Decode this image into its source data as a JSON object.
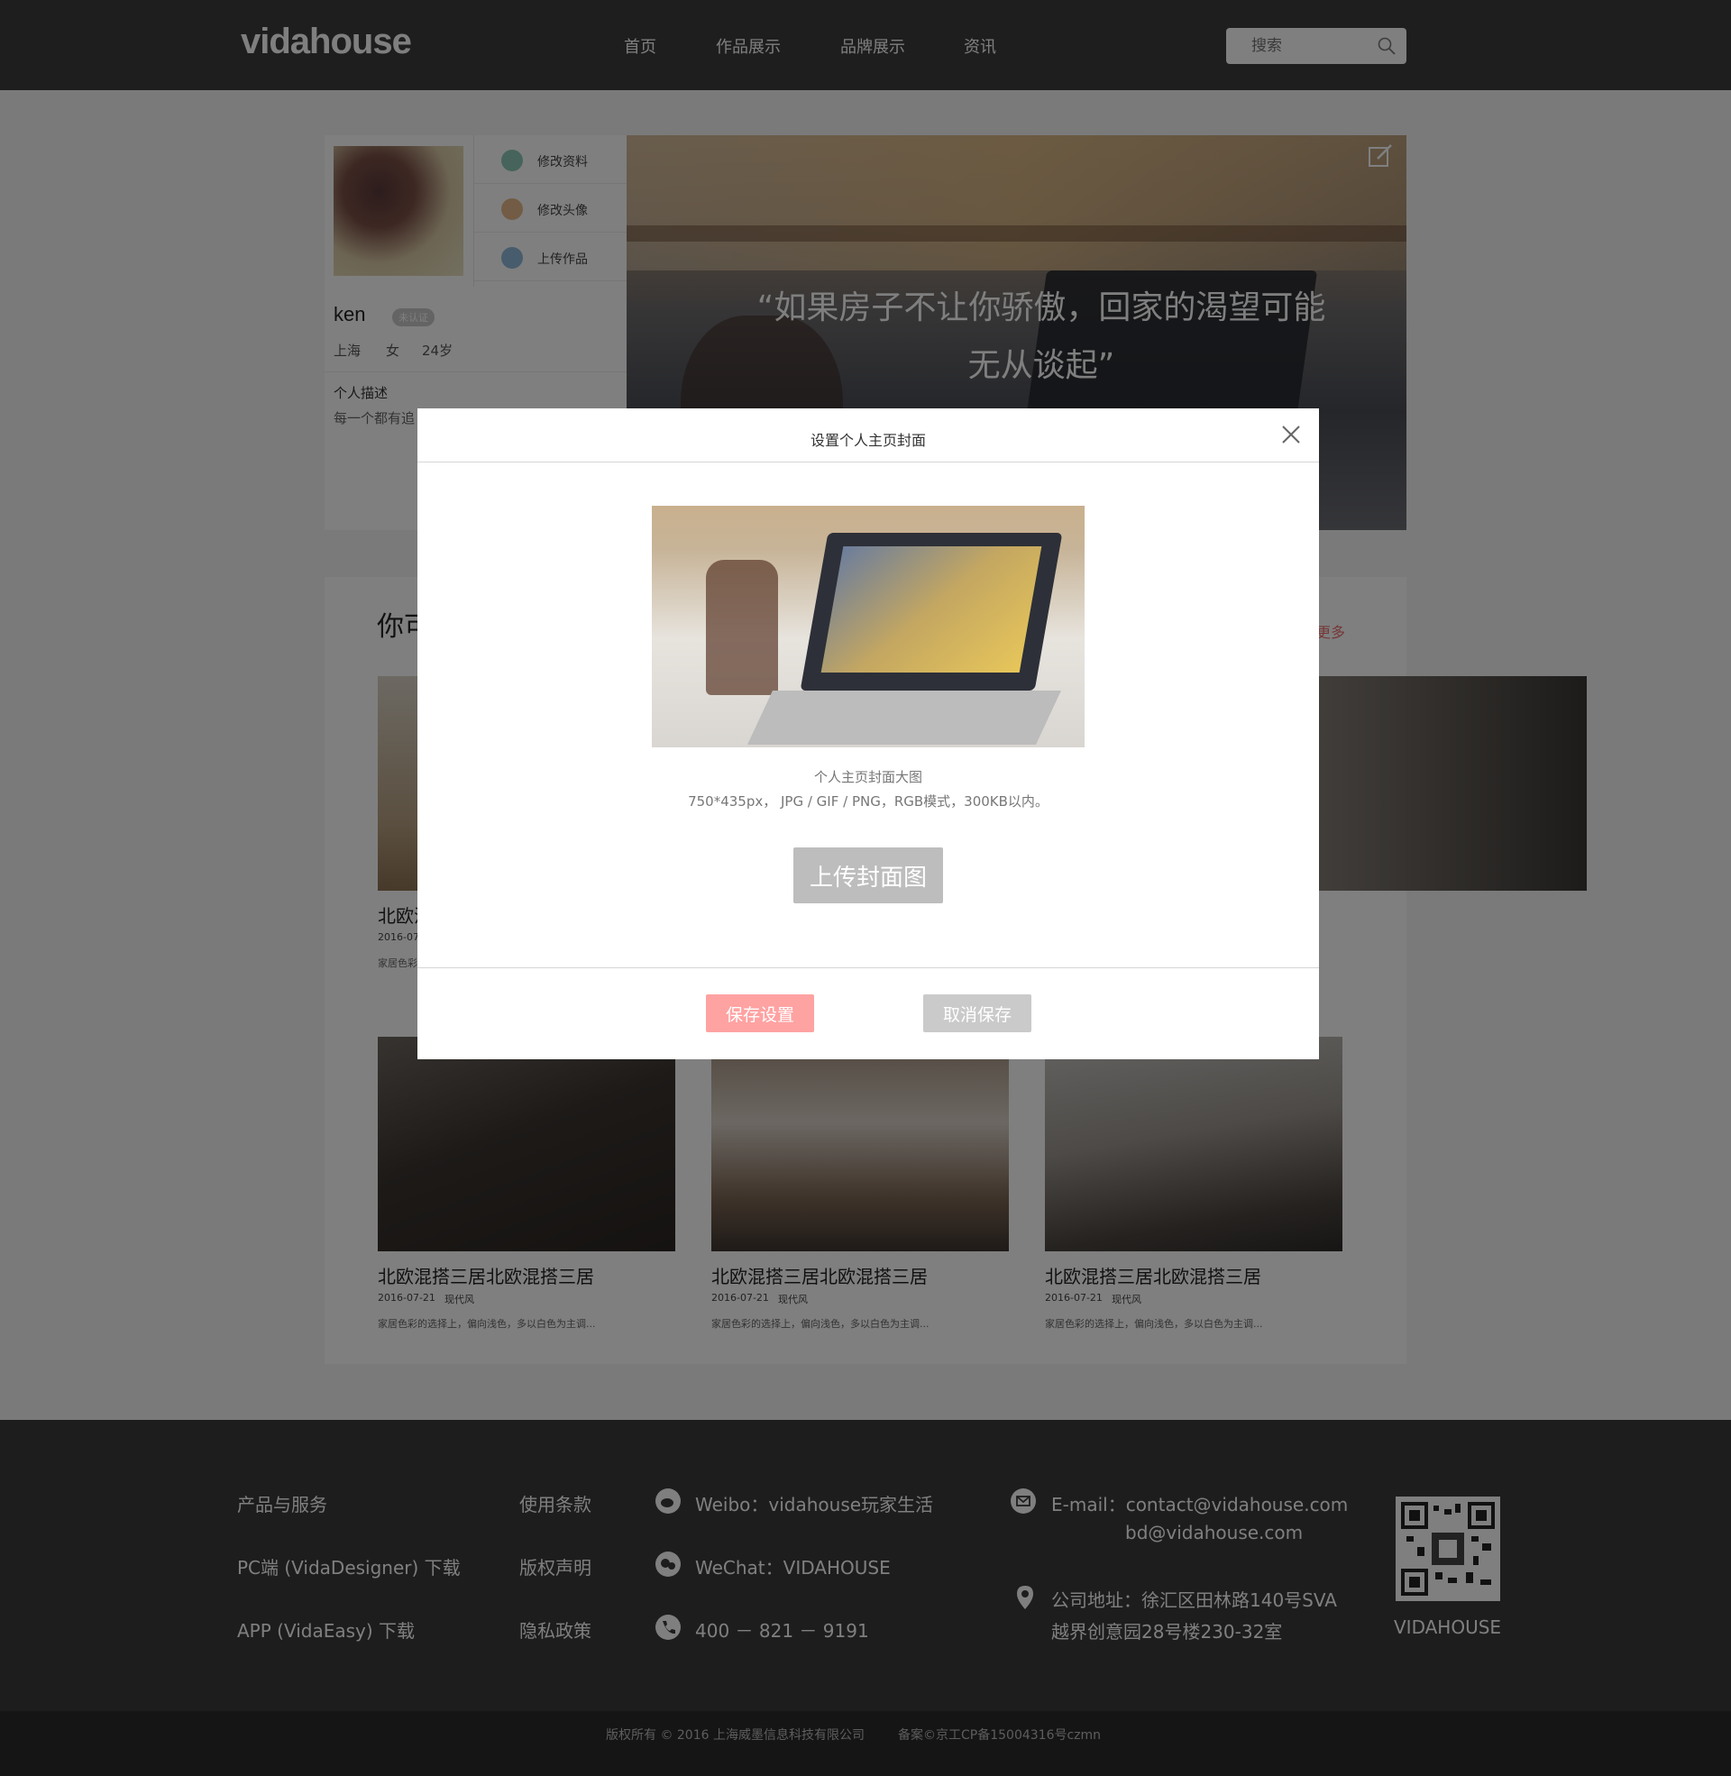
{
  "header": {
    "logo": "vidahouse",
    "nav": [
      "首页",
      "作品展示",
      "品牌展示",
      "资讯"
    ],
    "search_placeholder": "搜索"
  },
  "profile": {
    "menu": [
      {
        "label": "修改资料",
        "icon": "pencil-icon"
      },
      {
        "label": "修改头像",
        "icon": "user-icon"
      },
      {
        "label": "上传作品",
        "icon": "upload-icon"
      }
    ],
    "name": "ken",
    "badge": "未认证",
    "city": "上海",
    "gender": "女",
    "age": "24岁",
    "desc_title": "个人描述",
    "desc": "每一个都有追",
    "cover_quote": "“如果房子不让你骄傲，回家的渴望可能无从谈起”"
  },
  "works": {
    "title": "你可",
    "more": "更多",
    "cards": [
      {
        "title": "北欧混搭三居北欧混搭三居",
        "date": "2016-07-21",
        "style": "现代风",
        "desc": "家居色彩的选择上，偏向浅色，多以白色为主调..."
      },
      {
        "title": "北欧混搭三居北欧混搭三居",
        "date": "2016-07-21",
        "style": "现代风",
        "desc": "家居色彩的选择上，偏向浅色，多以白色为主调..."
      },
      {
        "title": "北欧混搭三居北欧混搭三居",
        "date": "2016-07-21",
        "style": "现代风",
        "desc": "家居色彩的选择上，偏向浅色，多以白色为主调..."
      }
    ],
    "top_card_title": "北欧混",
    "top_card_date": "2016-07",
    "top_card_desc": "家居色彩"
  },
  "footer": {
    "links_col1": [
      "产品与服务",
      "PC端 (VidaDesigner) 下载",
      "APP (VidaEasy) 下载"
    ],
    "links_col2": [
      "使用条款",
      "版权声明",
      "隐私政策"
    ],
    "weibo": "Weibo：vidahouse玩家生活",
    "wechat": "WeChat：VIDAHOUSE",
    "phone": "400 － 821 － 9191",
    "email": "E-mail：contact@vidahouse.com",
    "email2": "bd@vidahouse.com",
    "address1": "公司地址：徐汇区田林路140号SVA",
    "address2": "越界创意园28号楼230-32室",
    "qr_label": "VIDAHOUSE",
    "copyright": "版权所有 © 2016 上海威墨信息科技有限公司",
    "icp": "备案©京工CP备15004316号czmn"
  },
  "modal": {
    "title": "设置个人主页封面",
    "caption": "个人主页封面大图",
    "spec": "750*435px，  JPG / GIF / PNG，RGB模式，300KB以内。",
    "upload": "上传封面图",
    "save": "保存设置",
    "cancel": "取消保存"
  },
  "colors": {
    "header_bg": "#3c3c3c",
    "footer_bg": "#3a3a3a",
    "save_button": "#ffa2a2",
    "more_link": "#ee6f6f"
  }
}
